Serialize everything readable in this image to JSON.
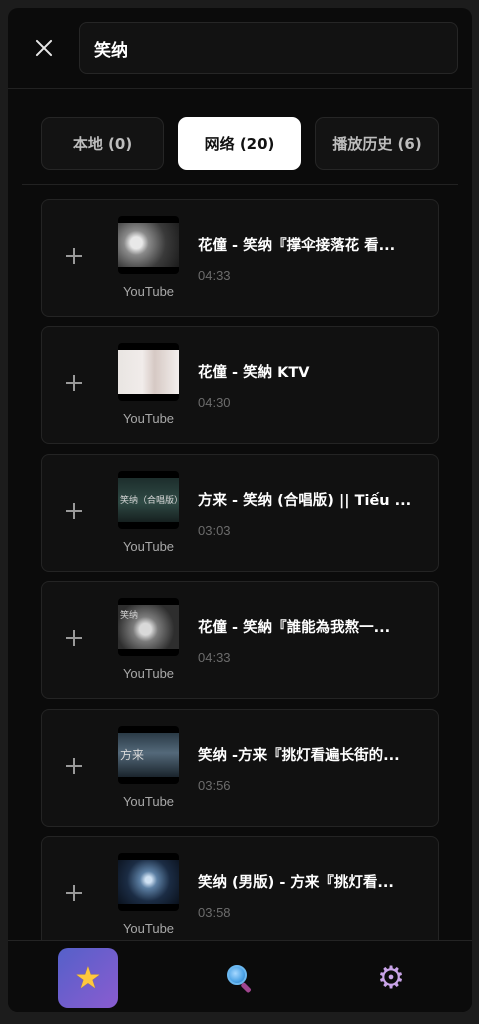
{
  "header": {
    "search_value": "笑纳"
  },
  "tabs": [
    {
      "label": "本地 (0)"
    },
    {
      "label": "网络 (20)"
    },
    {
      "label": "播放历史 (6)"
    }
  ],
  "results": [
    {
      "title": "花僮 - 笑纳『撑伞接落花 看...",
      "duration": "04:33",
      "source": "YouTube"
    },
    {
      "title": "花僮 - 笑納 KTV",
      "duration": "04:30",
      "source": "YouTube"
    },
    {
      "title": "方来 - 笑纳 (合唱版) || Tiếu ...",
      "duration": "03:03",
      "source": "YouTube",
      "thumb_text": "笑纳（合唱版）"
    },
    {
      "title": "花僮 - 笑納『誰能為我熬一...",
      "duration": "04:33",
      "source": "YouTube",
      "thumb_text": "笑纳"
    },
    {
      "title": "笑纳 -方来『挑灯看遍长街的...",
      "duration": "03:56",
      "source": "YouTube",
      "thumb_text": "方来"
    },
    {
      "title": "笑纳 (男版) - 方来『挑灯看...",
      "duration": "03:58",
      "source": "YouTube"
    }
  ],
  "nav": {
    "active": "favorites",
    "icons": [
      "star-icon",
      "search-icon",
      "gear-icon"
    ]
  },
  "colors": {
    "background": "#0b0b0b",
    "active_tab": "#ffffff",
    "nav_active": "#6a5ecf"
  }
}
